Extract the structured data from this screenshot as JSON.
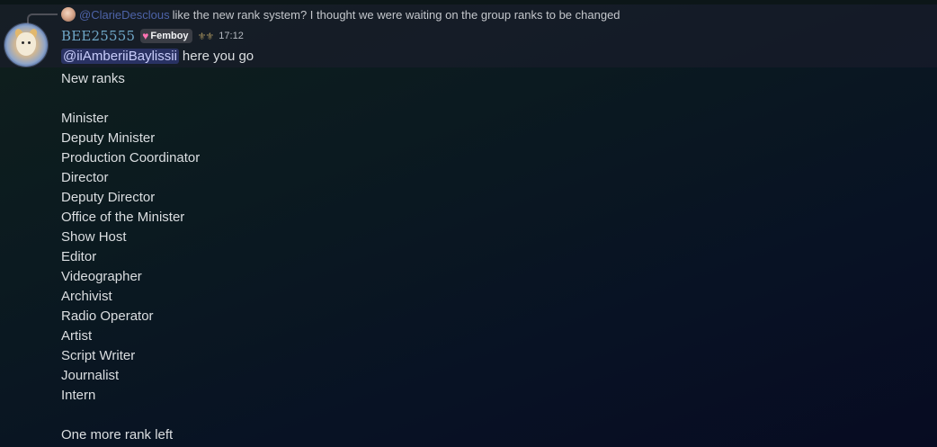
{
  "reply": {
    "username": "@ClarieDesclous",
    "text": "like the new rank system? I thought we were waiting on the group ranks to be changed"
  },
  "author": {
    "username": "BEE25555",
    "role_tag": "Femboy",
    "timestamp": "17:12"
  },
  "message": {
    "mention": "@iiAmberiiBaylissii",
    "first_text": "here you go",
    "lines": [
      "New ranks",
      "",
      "Minister",
      "Deputy Minister",
      "Production Coordinator",
      "Director",
      "Deputy Director",
      "Office of the Minister",
      "Show Host",
      "Editor",
      "Videographer",
      "Archivist",
      "Radio Operator",
      "Artist",
      "Script Writer",
      "Journalist",
      "Intern",
      "",
      "One more rank left"
    ]
  },
  "colors": {
    "username": "#6fa7c7",
    "reply_name": "#4d63a8",
    "mention_bg": "#5865f24d"
  },
  "icons": {
    "role": "heart-icon",
    "guild": "guild-tag-icon"
  }
}
